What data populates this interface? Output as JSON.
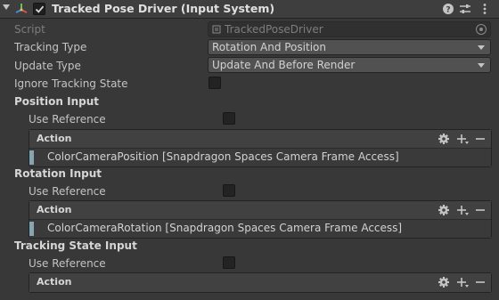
{
  "component": {
    "title": "Tracked Pose Driver (Input System)",
    "enabled": true,
    "icons": [
      "help-icon",
      "presets-icon",
      "more-icon"
    ]
  },
  "fields": {
    "script_label": "Script",
    "script_value": "TrackedPoseDriver",
    "tracking_type_label": "Tracking Type",
    "tracking_type_value": "Rotation And Position",
    "update_type_label": "Update Type",
    "update_type_value": "Update And Before Render",
    "ignore_tracking_state_label": "Ignore Tracking State"
  },
  "sections": [
    {
      "title": "Position Input",
      "use_reference_label": "Use Reference",
      "action_label": "Action",
      "binding": "ColorCameraPosition [Snapdragon Spaces Camera Frame Access]"
    },
    {
      "title": "Rotation Input",
      "use_reference_label": "Use Reference",
      "action_label": "Action",
      "binding": "ColorCameraRotation [Snapdragon Spaces Camera Frame Access]"
    },
    {
      "title": "Tracking State Input",
      "use_reference_label": "Use Reference",
      "action_label": "Action",
      "binding": ""
    }
  ],
  "colors": {
    "background": "#383838",
    "field": "#515151",
    "binding_marker": "#86a5b3"
  }
}
